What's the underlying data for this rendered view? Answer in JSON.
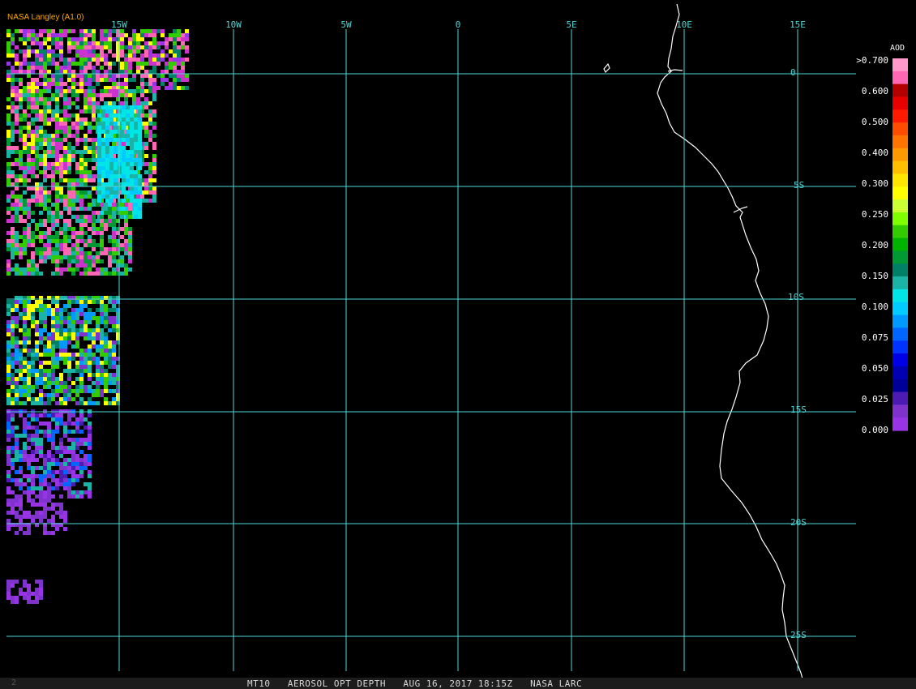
{
  "credit": "NASA Langley (A1.0)",
  "longitude_labels": [
    "15W",
    "10W",
    "5W",
    "0",
    "5E",
    "10E",
    "15E"
  ],
  "latitude_labels": [
    "0",
    "5S",
    "10S",
    "15S",
    "20S",
    "25S"
  ],
  "legend": {
    "title": "AOD",
    "labels": [
      ">0.700",
      "0.600",
      "0.500",
      "0.400",
      "0.300",
      "0.250",
      "0.200",
      "0.150",
      "0.100",
      "0.075",
      "0.050",
      "0.025",
      "0.000"
    ],
    "colors": [
      "#ff99cc",
      "#ff66b3",
      "#b30000",
      "#e60000",
      "#ff1a00",
      "#ff4d00",
      "#ff7300",
      "#ff9900",
      "#ffbf00",
      "#ffe600",
      "#ffff00",
      "#ccff33",
      "#80ff00",
      "#33cc00",
      "#00b300",
      "#009933",
      "#008066",
      "#1ab3a6",
      "#00e6e6",
      "#00ccff",
      "#0099ff",
      "#0066ff",
      "#0033ff",
      "#0000e6",
      "#0000b3",
      "#000099",
      "#4d1ab3",
      "#7f33cc",
      "#9933e6"
    ]
  },
  "footer": {
    "frame": "2",
    "product": "MT10",
    "title": "AEROSOL OPT DEPTH",
    "date": "AUG 16, 2017 18:15Z",
    "source": "NASA LARC"
  }
}
